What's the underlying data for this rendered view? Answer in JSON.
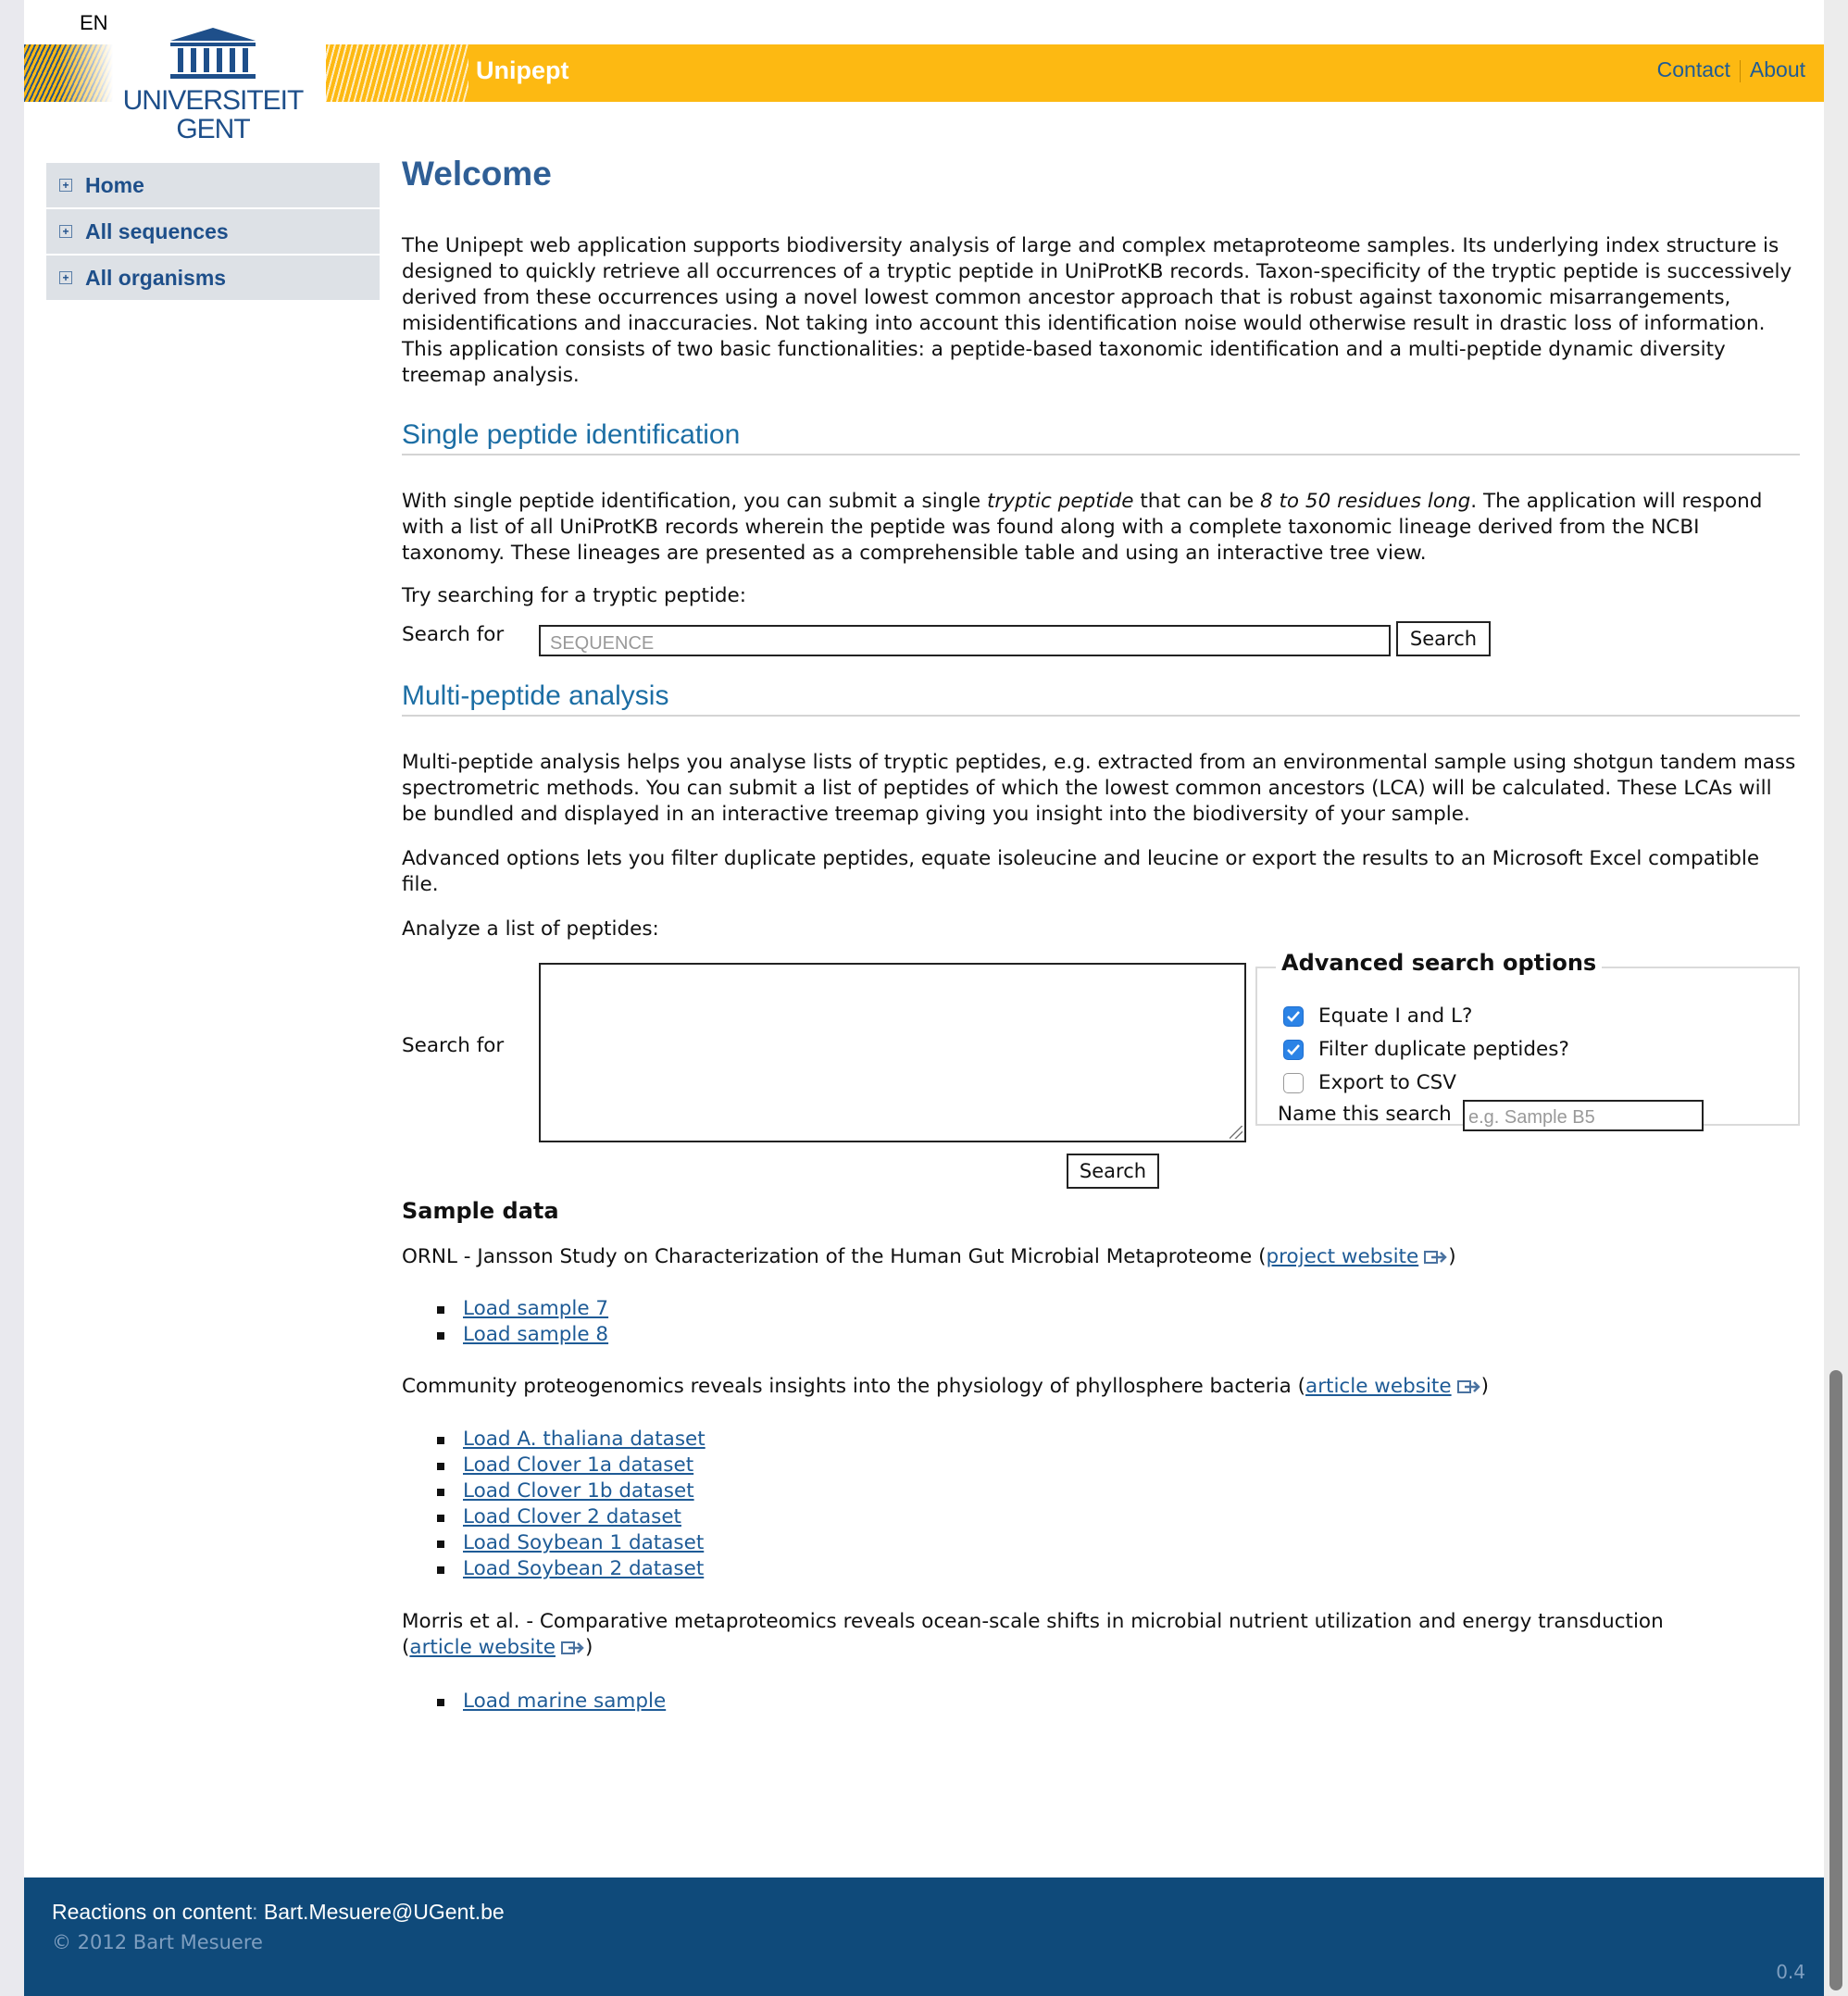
{
  "lang": "EN",
  "header": {
    "brand": "Unipept",
    "logo_line1": "UNIVERSITEIT",
    "logo_line2": "GENT",
    "links": {
      "contact": "Contact",
      "about": "About"
    }
  },
  "sidebar": {
    "items": [
      {
        "label": "Home"
      },
      {
        "label": "All sequences"
      },
      {
        "label": "All organisms"
      }
    ]
  },
  "main": {
    "title": "Welcome",
    "intro": "The Unipept web application supports biodiversity analysis of large and complex metaproteome samples. Its underlying index structure is designed to quickly retrieve all occurrences of a tryptic peptide in UniProtKB records. Taxon-specificity of the tryptic peptide is successively derived from these occurrences using a novel lowest common ancestor approach that is robust against taxonomic misarrangements, misidentifications and inaccuracies. Not taking into account this identification noise would otherwise result in drastic loss of information. This application consists of two basic functionalities: a peptide-based taxonomic identification and a multi-peptide dynamic diversity treemap analysis.",
    "single": {
      "heading": "Single peptide identification",
      "p_part1": "With single peptide identification, you can submit a single ",
      "p_em1": "tryptic peptide",
      "p_part2": " that can be ",
      "p_em2": "8 to 50 residues long",
      "p_part3": ". The application will respond with a list of all UniProtKB records wherein the peptide was found along with a complete taxonomic lineage derived from the NCBI taxonomy. These lineages are presented as a comprehensible table and using an interactive tree view.",
      "try_text": "Try searching for a tryptic peptide:",
      "search_label": "Search for",
      "search_placeholder": "SEQUENCE",
      "search_button": "Search"
    },
    "multi": {
      "heading": "Multi-peptide analysis",
      "p1": "Multi-peptide analysis helps you analyse lists of tryptic peptides, e.g. extracted from an environmental sample using shotgun tandem mass spectrometric methods. You can submit a list of peptides of which the lowest common ancestors (LCA) will be calculated. These LCAs will be bundled and displayed in an interactive treemap giving you insight into the biodiversity of your sample.",
      "p2": "Advanced options lets you filter duplicate peptides, equate isoleucine and leucine or export the results to an Microsoft Excel compatible file.",
      "analyze_text": "Analyze a list of peptides:",
      "search_label": "Search for",
      "search_button": "Search",
      "advanced": {
        "legend": "Advanced search options",
        "opt1": {
          "label": "Equate I and L?",
          "checked": true
        },
        "opt2": {
          "label": "Filter duplicate peptides?",
          "checked": true
        },
        "opt3": {
          "label": "Export to CSV",
          "checked": false
        },
        "name_label": "Name this search",
        "name_placeholder": "e.g. Sample B5"
      }
    },
    "samples": {
      "heading": "Sample data",
      "groups": [
        {
          "title": "ORNL - Jansson Study on Characterization of the Human Gut Microbial Metaproteome (",
          "link": "project website",
          "close": ")",
          "items": [
            "Load sample 7",
            "Load sample 8"
          ]
        },
        {
          "title": "Community proteogenomics reveals insights into the physiology of phyllosphere bacteria (",
          "link": "article website",
          "close": ")",
          "items": [
            "Load A. thaliana dataset",
            "Load Clover 1a dataset",
            "Load Clover 1b dataset",
            "Load Clover 2 dataset",
            "Load Soybean 1 dataset",
            "Load Soybean 2 dataset"
          ]
        },
        {
          "title": "Morris et al. - Comparative metaproteomics reveals ocean-scale shifts in microbial nutrient utilization and energy transduction",
          "title_open": "(",
          "link": "article website",
          "close": ")",
          "items": [
            "Load marine sample"
          ]
        }
      ]
    }
  },
  "footer": {
    "reactions_label": "Reactions on content",
    "colon": ":",
    "email": "Bart.Mesuere@UGent.be",
    "copyright": "© 2012 Bart Mesuere",
    "version": "0.4"
  },
  "colors": {
    "banner": "#fdb912",
    "footer": "#0f4a7a",
    "heading": "#1c6ea4",
    "link": "#1e5b96"
  }
}
